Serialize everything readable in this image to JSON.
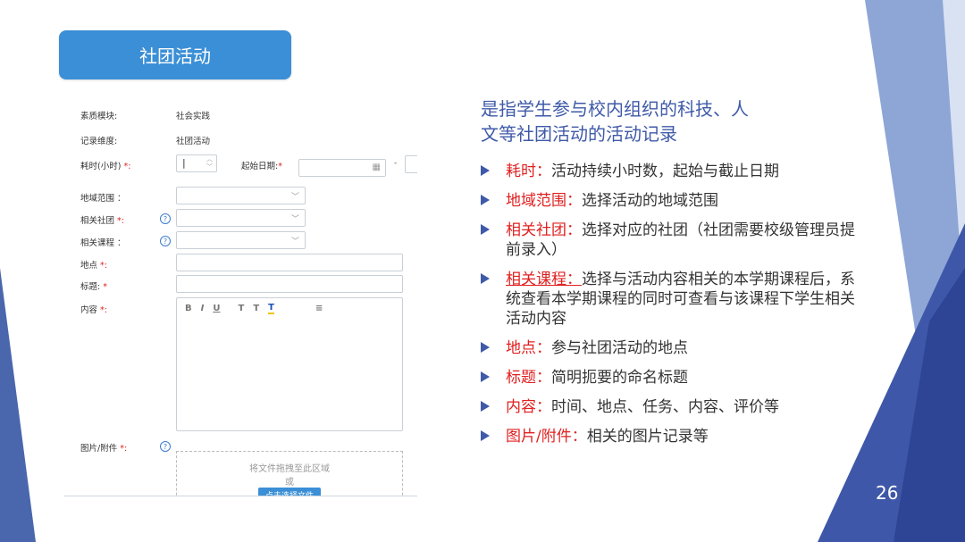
{
  "slide": {
    "title": "社团活动",
    "page_number": "26"
  },
  "form": {
    "rows": [
      {
        "label": "素质模块:",
        "value": "社会实践"
      },
      {
        "label": "记录维度:",
        "value": "社团活动"
      }
    ],
    "duration_label": "耗时(小时)",
    "start_date_label": "起始日期:",
    "dash": "-",
    "region_label": "地域范围 ：",
    "club_label": "相关社团",
    "course_label": "相关课程 ：",
    "place_label": "地点",
    "title_label": "标题:",
    "content_label": "内容",
    "attach_label": "图片/附件",
    "required_mark": "*:",
    "required_star": "*",
    "help_glyph": "?",
    "toolbar": [
      "B",
      "I",
      "U",
      "T",
      "T",
      "T",
      "≡"
    ],
    "drop_text": "将文件拖拽至此区域",
    "drop_or": "或",
    "drop_button": "点击选择文件"
  },
  "right": {
    "heading_line1": "是指学生参与校内组织的科技、人",
    "heading_line2": "文等社团活动的活动记录",
    "items": [
      {
        "key": "耗时：",
        "text": "活动持续小时数，起始与截止日期"
      },
      {
        "key": "地域范围：",
        "text": "选择活动的地域范围"
      },
      {
        "key": "相关社团：",
        "text": "选择对应的社团（社团需要校级管理员提前录入）"
      },
      {
        "key": "相关课程：",
        "text": "选择与活动内容相关的本学期课程后，系统查看本学期课程的同时可查看与该课程下学生相关活动内容"
      },
      {
        "key": "地点：",
        "text": "参与社团活动的地点"
      },
      {
        "key": "标题：",
        "text": "简明扼要的命名标题"
      },
      {
        "key": "内容：",
        "text": "时间、地点、任务、内容、评价等"
      },
      {
        "key": "图片/附件：",
        "text": "相关的图片记录等"
      }
    ]
  },
  "colors": {
    "accent": "#3b8fd6",
    "heading": "#3f5aa8",
    "key": "#e02020"
  }
}
